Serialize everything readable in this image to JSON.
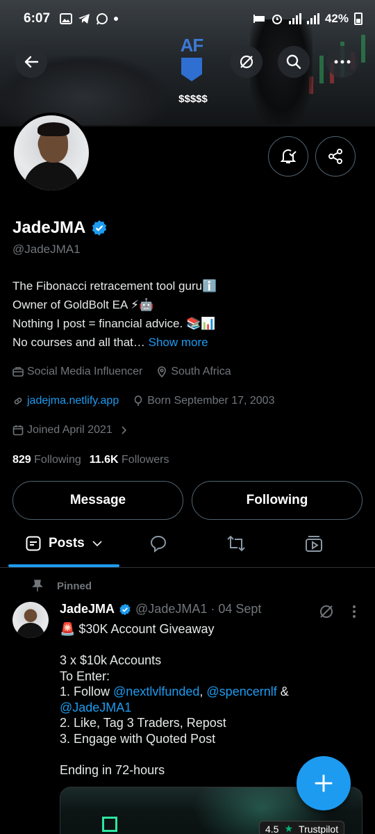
{
  "status_bar": {
    "time": "6:07",
    "battery": "42%"
  },
  "banner": {
    "logo_text": "AF",
    "money_text": "$$$$$"
  },
  "profile": {
    "name": "JadeJMA",
    "handle": "@JadeJMA1",
    "bio_lines": [
      "The Fibonacci retracement tool guruℹ️",
      "Owner of GoldBolt EA ⚡🤖",
      "Nothing I post = financial advice. 📚📊",
      "No courses and all that…"
    ],
    "show_more": "Show more",
    "category": "Social Media Influencer",
    "location": "South Africa",
    "website": "jadejma.netlify.app",
    "born": "Born September 17, 2003",
    "joined": "Joined April 2021",
    "following_count": "829",
    "following_label": "Following",
    "followers_count": "11.6K",
    "followers_label": "Followers"
  },
  "actions": {
    "message": "Message",
    "following": "Following"
  },
  "tabs": {
    "posts": "Posts"
  },
  "pinned_label": "Pinned",
  "tweet": {
    "name": "JadeJMA",
    "handle_date": "@JadeJMA1 · 04 Sept",
    "line1": "🚨 $30K Account Giveaway",
    "line2": "3 x $10k Accounts",
    "line3": "To Enter:",
    "line4_prefix": "1. Follow ",
    "mention1": "@nextlvlfunded",
    "sep": ", ",
    "mention2": "@spencernlf",
    "amp": " &",
    "mention3": "@JadeJMA1",
    "line5": "2. Like, Tag 3 Traders, Repost",
    "line6": "3. Engage with Quoted Post",
    "line7": "Ending in 72-hours"
  },
  "media": {
    "rating": "4.5",
    "trustpilot": "Trustpilot"
  },
  "colors": {
    "accent": "#1d9bf0",
    "muted": "#71767b",
    "border": "#536471"
  }
}
